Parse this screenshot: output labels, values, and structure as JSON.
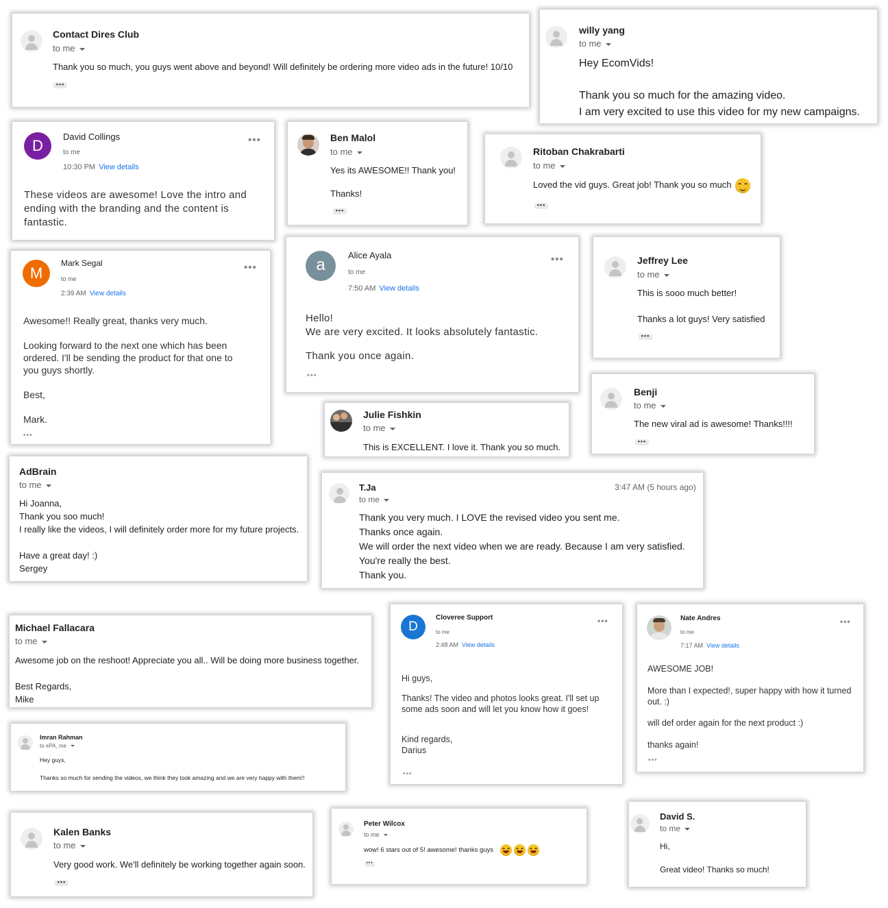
{
  "colors": {
    "link": "#1a73e8",
    "avatar_purple": "#7b1fa2",
    "avatar_orange": "#ef6c00",
    "avatar_slate": "#78909c",
    "avatar_blue": "#1976d2"
  },
  "cards": {
    "contact_dires": {
      "name": "Contact Dires Club",
      "to": "to me",
      "body": "Thank you so much, you guys went above and beyond! Will definitely be ordering more video ads in the future! 10/10"
    },
    "willy": {
      "name": "willy yang",
      "to": "to me",
      "line1": "Hey EcomVids!",
      "line2": "Thank you so much for the amazing video.",
      "line3": "I am very excited to use this video for my new campaigns."
    },
    "david_collings": {
      "initial": "D",
      "name": "David Collings",
      "to": "to me",
      "time": "10:30 PM",
      "view": "View details",
      "body": "These videos are awesome! Love the intro and ending with the branding and the content is fantastic."
    },
    "ben": {
      "name": "Ben Malol",
      "to": "to me",
      "line1": "Yes its AWESOME!! Thank you!",
      "line2": "Thanks!"
    },
    "ritoban": {
      "name": "Ritoban Chakrabarti",
      "to": "to me",
      "body": "Loved the vid guys. Great job! Thank you so much"
    },
    "mark": {
      "initial": "M",
      "name": "Mark Segal",
      "to": "to me",
      "time": "2:39 AM",
      "view": "View details",
      "line1": "Awesome!! Really great, thanks very much.",
      "line2": "Looking forward to the next one which has been ordered. I'll be sending the product for that one to you guys shortly.",
      "line3": "Best,",
      "line4": "Mark."
    },
    "alice": {
      "initial": "a",
      "name": "Alice Ayala",
      "to": "to me",
      "time": "7:50 AM",
      "view": "View details",
      "line1": "Hello!",
      "line2": "We are very excited. It looks absolutely fantastic.",
      "line3": "Thank you once again."
    },
    "jeffrey": {
      "name": "Jeffrey Lee",
      "to": "to me",
      "line1": "This is sooo much better!",
      "line2": "Thanks a lot guys! Very satisfied"
    },
    "julie": {
      "name": "Julie Fishkin",
      "to": "to me",
      "body": "This is EXCELLENT. I love it. Thank you so much."
    },
    "benji": {
      "name": "Benji",
      "to": "to me",
      "body": "The new viral ad is awesome! Thanks!!!!"
    },
    "adbrain": {
      "name": "AdBrain",
      "to": "to me",
      "line1": "Hi Joanna,",
      "line2": "Thank you soo much!",
      "line3": "I really like the videos, I will definitely order more for my future projects.",
      "line4": "Have a great day! :)",
      "line5": "Sergey"
    },
    "tja": {
      "name": "T.Ja",
      "to": "to me",
      "time": "3:47 AM (5 hours ago)",
      "line1": "Thank you very much. I LOVE the revised video you sent me.",
      "line2": "Thanks once again.",
      "line3": "We will order the next video when we are ready. Because I am very satisfied.",
      "line4": "You're really the best.",
      "line5": "Thank you."
    },
    "michael": {
      "name": "Michael Fallacara",
      "to": "to me",
      "line1": "Awesome job on the reshoot!   Appreciate you all.. Will be doing more business together.",
      "line2": "Best Regards,",
      "line3": "Mike"
    },
    "cloveree": {
      "initial": "D",
      "name": "Cloveree Support",
      "to": "to me",
      "time": "2:48 AM",
      "view": "View details",
      "line1": "Hi guys,",
      "line2": "Thanks! The video and photos looks great. I'll set up some ads soon and will let you know how it goes!",
      "line3": "Kind regards,",
      "line4": "Darius"
    },
    "nate": {
      "name": "Nate Andres",
      "to": "to me",
      "time": "7:17 AM",
      "view": "View details",
      "line1": "AWESOME JOB!",
      "line2": "More than I expected!, super happy with how it turned out.  :)",
      "line3": "will def order again for the next product :)",
      "line4": "thanks again!"
    },
    "imran": {
      "name": "Imran Rahman",
      "to": "to ePA, me",
      "line1": "Hey guys,",
      "line2": "Thanks so much for sending the videos, we think they look amazing and we are very happy with them!!"
    },
    "kalen": {
      "name": "Kalen Banks",
      "to": "to me",
      "body": "Very good work. We'll definitely be working together again soon."
    },
    "peter": {
      "name": "Peter Wilcox",
      "to": "to me",
      "body": "wow! 6 stars out of 5! awesome! thanks guys"
    },
    "david_s": {
      "name": "David S.",
      "to": "to me",
      "line1": "Hi,",
      "line2": "Great video! Thanks so much!"
    }
  }
}
